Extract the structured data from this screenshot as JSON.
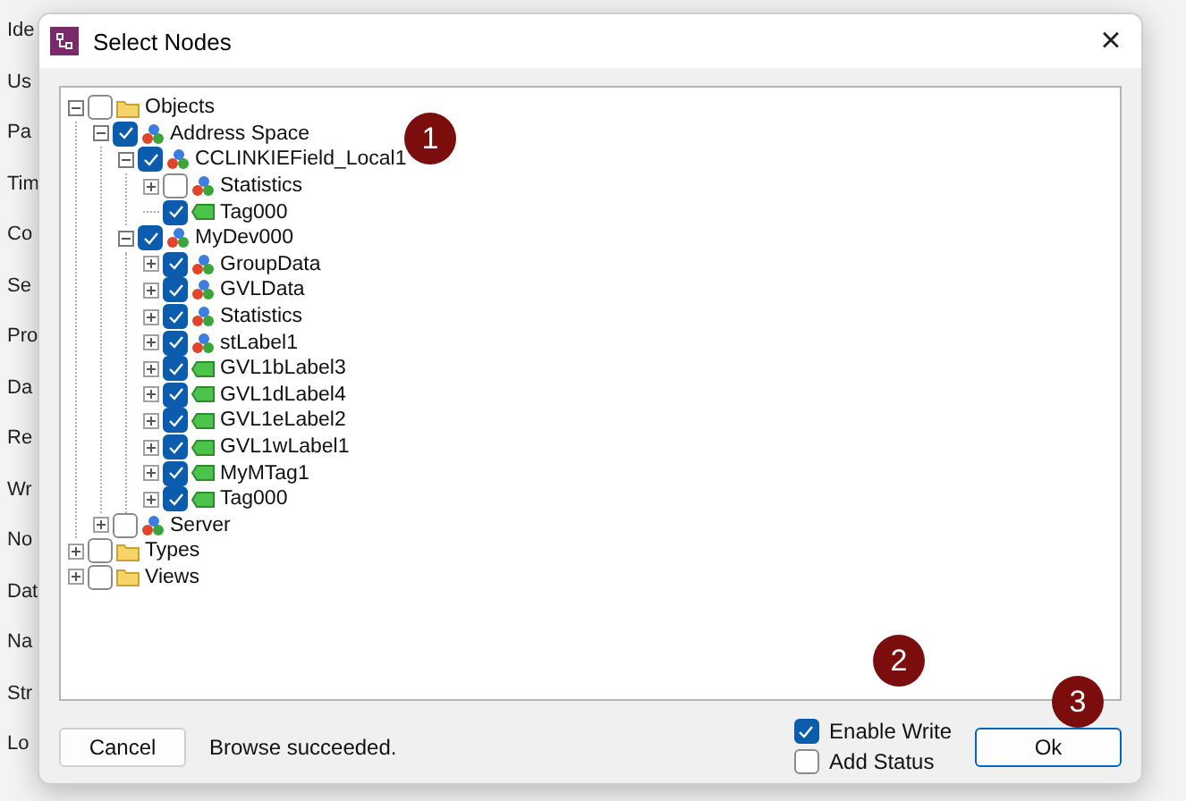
{
  "background_labels": [
    "Ide",
    "Us",
    "Pa",
    "Tim",
    "Co",
    "Se",
    "Pro",
    "Da",
    "Re",
    "Wr",
    "No",
    "Dat",
    "Na",
    "Str",
    "Lo"
  ],
  "window": {
    "title": "Select Nodes",
    "close": "×"
  },
  "tree": [
    {
      "label": "Objects",
      "kind": "folder",
      "checked": false,
      "expandable": true,
      "expanded": true,
      "children": [
        {
          "label": "Address Space",
          "kind": "object",
          "checked": true,
          "expandable": true,
          "expanded": true,
          "children": [
            {
              "label": "CCLINKIEField_Local1",
              "kind": "object",
              "checked": true,
              "expandable": true,
              "expanded": true,
              "children": [
                {
                  "label": "Statistics",
                  "kind": "object",
                  "checked": false,
                  "expandable": true,
                  "expanded": false
                },
                {
                  "label": "Tag000",
                  "kind": "tag",
                  "checked": true,
                  "expandable": false
                }
              ]
            },
            {
              "label": "MyDev000",
              "kind": "object",
              "checked": true,
              "expandable": true,
              "expanded": true,
              "children": [
                {
                  "label": "GroupData",
                  "kind": "object",
                  "checked": true,
                  "expandable": true,
                  "expanded": false
                },
                {
                  "label": "GVLData",
                  "kind": "object",
                  "checked": true,
                  "expandable": true,
                  "expanded": false
                },
                {
                  "label": "Statistics",
                  "kind": "object",
                  "checked": true,
                  "expandable": true,
                  "expanded": false
                },
                {
                  "label": "stLabel1",
                  "kind": "object",
                  "checked": true,
                  "expandable": true,
                  "expanded": false
                },
                {
                  "label": "GVL1bLabel3",
                  "kind": "tag",
                  "checked": true,
                  "expandable": true,
                  "expanded": false
                },
                {
                  "label": "GVL1dLabel4",
                  "kind": "tag",
                  "checked": true,
                  "expandable": true,
                  "expanded": false
                },
                {
                  "label": "GVL1eLabel2",
                  "kind": "tag",
                  "checked": true,
                  "expandable": true,
                  "expanded": false
                },
                {
                  "label": "GVL1wLabel1",
                  "kind": "tag",
                  "checked": true,
                  "expandable": true,
                  "expanded": false
                },
                {
                  "label": "MyMTag1",
                  "kind": "tag",
                  "checked": true,
                  "expandable": true,
                  "expanded": false
                },
                {
                  "label": "Tag000",
                  "kind": "tag",
                  "checked": true,
                  "expandable": true,
                  "expanded": false
                }
              ]
            }
          ]
        },
        {
          "label": "Server",
          "kind": "object",
          "checked": false,
          "expandable": true,
          "expanded": false
        }
      ]
    },
    {
      "label": "Types",
      "kind": "folder",
      "checked": false,
      "expandable": true,
      "expanded": false
    },
    {
      "label": "Views",
      "kind": "folder",
      "checked": false,
      "expandable": true,
      "expanded": false
    }
  ],
  "footer": {
    "cancel": "Cancel",
    "status": "Browse succeeded.",
    "options": [
      {
        "label": "Enable Write",
        "checked": true
      },
      {
        "label": "Add Status",
        "checked": false
      }
    ],
    "ok": "Ok"
  },
  "callouts": [
    "1",
    "2",
    "3"
  ]
}
